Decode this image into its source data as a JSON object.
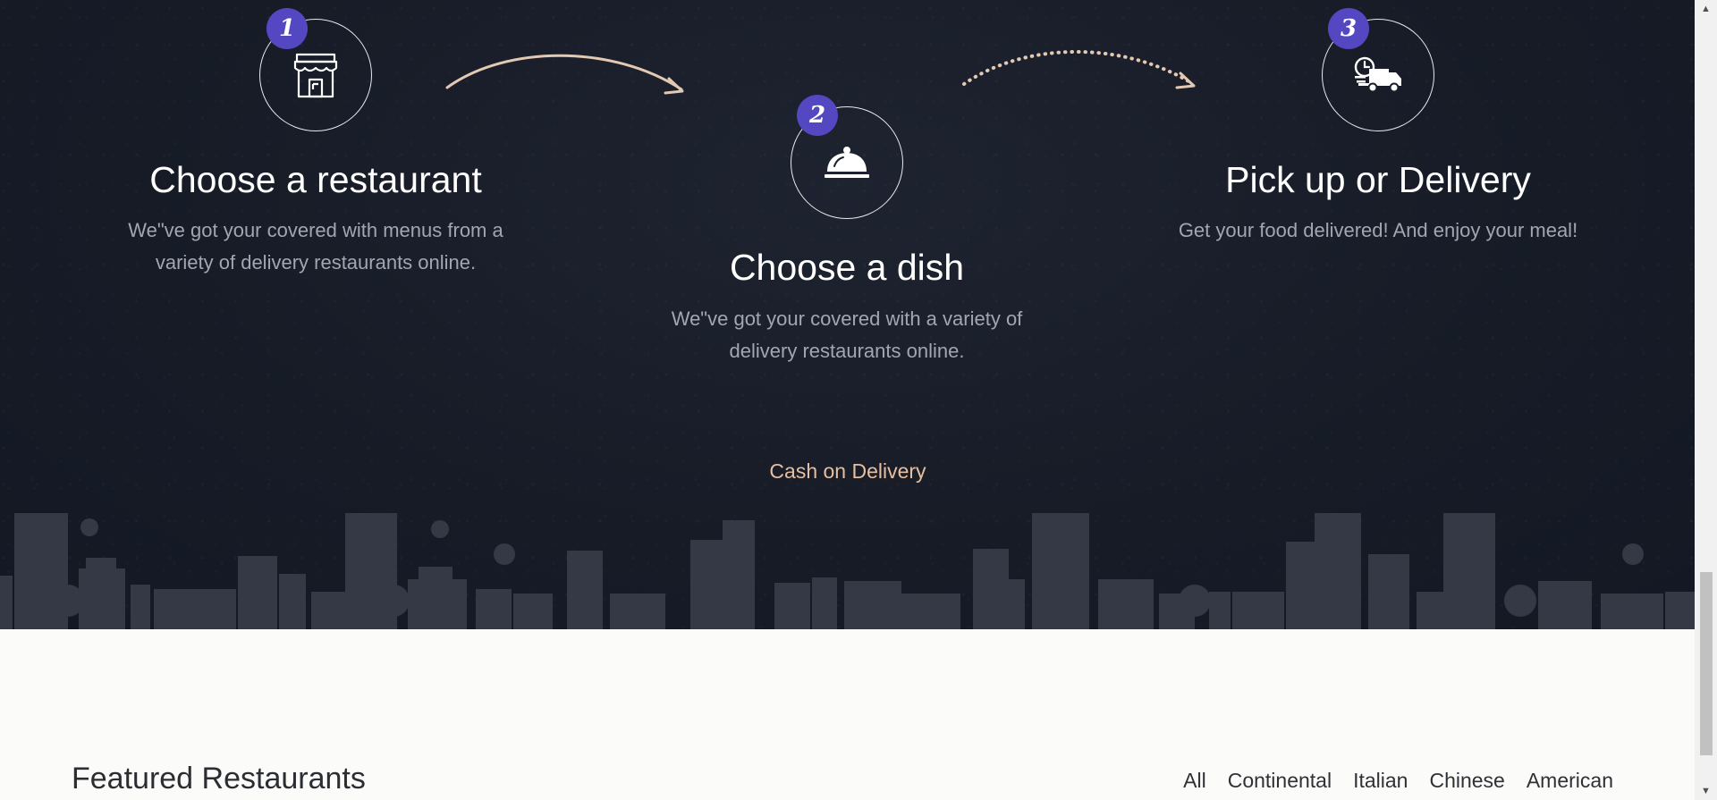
{
  "steps": [
    {
      "number": "1",
      "icon": "storefront-icon",
      "title": "Choose a restaurant",
      "desc_line1": "We\"ve got your covered with menus from a",
      "desc_line2": "variety of delivery restaurants online."
    },
    {
      "number": "2",
      "icon": "cloche-icon",
      "title": "Choose a dish",
      "desc_line1": "We\"ve got your covered with a variety of",
      "desc_line2": "delivery restaurants online."
    },
    {
      "number": "3",
      "icon": "delivery-truck-icon",
      "title": "Pick up or Delivery",
      "desc_line1": "Get your food delivered! And enjoy your meal!",
      "desc_line2": ""
    }
  ],
  "cash_on_delivery": "Cash on Delivery",
  "featured": {
    "title": "Featured Restaurants",
    "filters": [
      "All",
      "Continental",
      "Italian",
      "Chinese",
      "American"
    ]
  },
  "colors": {
    "dark_bg": "#161b26",
    "badge": "#5447c2",
    "accent_link": "#e6bea0",
    "page_bg": "#fbfbf9"
  }
}
